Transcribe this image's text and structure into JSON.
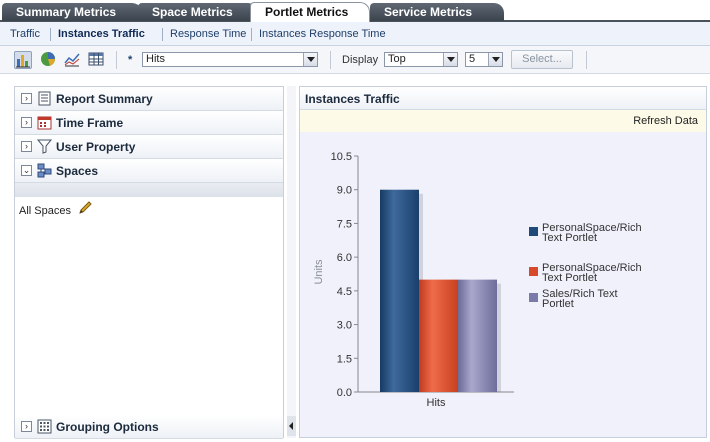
{
  "tabs": [
    {
      "label": "Summary Metrics"
    },
    {
      "label": "Space Metrics"
    },
    {
      "label": "Portlet Metrics"
    },
    {
      "label": "Service Metrics"
    }
  ],
  "active_tab": "Portlet Metrics",
  "subtabs": [
    {
      "label": "Traffic"
    },
    {
      "label": "Instances Traffic"
    },
    {
      "label": "Response Time"
    },
    {
      "label": "Instances Response Time"
    }
  ],
  "active_subtab": "Instances Traffic",
  "toolbar": {
    "icons": [
      "bar-chart-icon",
      "pie-chart-icon",
      "line-chart-icon",
      "table-icon"
    ],
    "required_marker": "*",
    "metric_value": "Hits",
    "display_label": "Display",
    "display_value": "Top",
    "count_value": "5",
    "select_button": "Select..."
  },
  "left_panel": {
    "sections": {
      "report_summary": "Report Summary",
      "time_frame": "Time Frame",
      "user_property": "User Property",
      "spaces": "Spaces",
      "grouping_options": "Grouping Options"
    },
    "spaces_value": "All Spaces"
  },
  "right_panel": {
    "title": "Instances Traffic",
    "refresh_link": "Refresh Data"
  },
  "chart_data": {
    "type": "bar",
    "categories": [
      "Hits"
    ],
    "series": [
      {
        "name": "PersonalSpace/Rich Text Portlet",
        "values": [
          9.0
        ],
        "color": "#1f4a7a"
      },
      {
        "name": "PersonalSpace/Rich Text Portlet",
        "values": [
          5.0
        ],
        "color": "#d8482a"
      },
      {
        "name": "Sales/Rich Text Portlet",
        "values": [
          5.0
        ],
        "color": "#7c7aa8"
      }
    ],
    "legend_lines": [
      [
        "PersonalSpace/Rich",
        "Text Portlet"
      ],
      [
        "PersonalSpace/Rich",
        "Text Portlet"
      ],
      [
        "Sales/Rich Text",
        "Portlet"
      ]
    ],
    "ylabel": "Units",
    "ylim": [
      0,
      10.5
    ],
    "yticks": [
      "10.5",
      "9.0",
      "7.5",
      "6.0",
      "4.5",
      "3.0",
      "1.5",
      "0.0"
    ],
    "legend_position": "right",
    "grid": false
  }
}
